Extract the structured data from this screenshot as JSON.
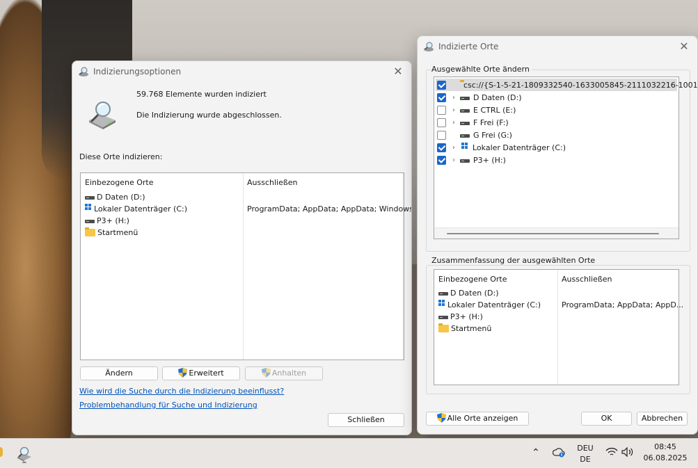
{
  "indexing_options": {
    "title": "Indizierungsoptionen",
    "count_text": "59.768 Elemente wurden indiziert",
    "status_text": "Die Indizierung wurde abgeschlossen.",
    "section_label": "Diese Orte indizieren:",
    "columns": [
      "Einbezogene Orte",
      "Ausschließen"
    ],
    "rows": [
      {
        "icon": "drive-icon",
        "name": "D Daten (D:)",
        "exclude": ""
      },
      {
        "icon": "windows-drive-icon",
        "name": "Lokaler Datenträger (C:)",
        "exclude": "ProgramData; AppData; AppData; Windows"
      },
      {
        "icon": "drive-icon",
        "name": "P3+ (H:)",
        "exclude": ""
      },
      {
        "icon": "folder-icon",
        "name": "Startmenü",
        "exclude": ""
      }
    ],
    "buttons": {
      "modify": "Ändern",
      "advanced": "Erweitert",
      "pause": "Anhalten",
      "close": "Schließen"
    },
    "links": {
      "how_affects": "Wie wird die Suche durch die Indizierung beeinflusst?",
      "troubleshoot": "Problembehandlung für Suche und Indizierung"
    }
  },
  "indexed_locations": {
    "title": "Indizierte Orte",
    "change_group_label": "Ausgewählte Orte ändern",
    "tree": [
      {
        "checked": true,
        "expander": false,
        "icon": "folder-icon",
        "label": "csc://{S-1-5-21-1809332540-1633005845-2111032216-1001",
        "selected": true
      },
      {
        "checked": true,
        "expander": true,
        "icon": "drive-icon",
        "label": "D Daten (D:)",
        "selected": false
      },
      {
        "checked": false,
        "expander": true,
        "icon": "drive-icon",
        "label": "E CTRL (E:)",
        "selected": false
      },
      {
        "checked": false,
        "expander": true,
        "icon": "drive-icon",
        "label": "F Frei (F:)",
        "selected": false
      },
      {
        "checked": false,
        "expander": false,
        "icon": "drive-icon",
        "label": "G Frei (G:)",
        "selected": false
      },
      {
        "checked": true,
        "expander": true,
        "icon": "windows-drive-icon",
        "label": "Lokaler Datenträger (C:)",
        "selected": false
      },
      {
        "checked": true,
        "expander": true,
        "icon": "drive-icon",
        "label": "P3+ (H:)",
        "selected": false
      }
    ],
    "summary_group_label": "Zusammenfassung der ausgewählten Orte",
    "columns": [
      "Einbezogene Orte",
      "Ausschließen"
    ],
    "rows": [
      {
        "icon": "drive-icon",
        "name": "D Daten (D:)",
        "exclude": ""
      },
      {
        "icon": "windows-drive-icon",
        "name": "Lokaler Datenträger (C:)",
        "exclude": "ProgramData; AppData; AppD..."
      },
      {
        "icon": "drive-icon",
        "name": "P3+ (H:)",
        "exclude": ""
      },
      {
        "icon": "folder-icon",
        "name": "Startmenü",
        "exclude": ""
      }
    ],
    "buttons": {
      "show_all": "Alle Orte anzeigen",
      "ok": "OK",
      "cancel": "Abbrechen"
    }
  },
  "taskbar": {
    "lang_top": "DEU",
    "lang_bottom": "DE",
    "time": "08:45",
    "date": "06.08.2025"
  },
  "colors": {
    "accent": "#1a66c9",
    "link": "#0053b8"
  }
}
